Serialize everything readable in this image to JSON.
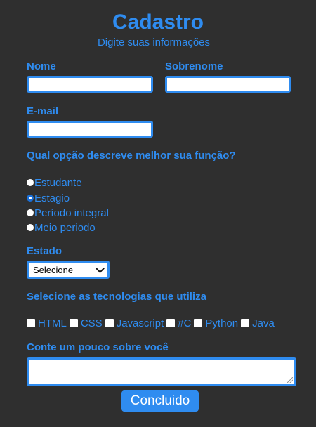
{
  "header": {
    "title": "Cadastro",
    "subtitle": "Digite suas informações"
  },
  "fields": {
    "nome_label": "Nome",
    "nome_value": "",
    "sobrenome_label": "Sobrenome",
    "sobrenome_value": "",
    "email_label": "E-mail",
    "email_value": ""
  },
  "role": {
    "question": "Qual opção descreve melhor sua função?",
    "options": [
      {
        "label": "Estudante",
        "checked": false
      },
      {
        "label": "Estagio",
        "checked": true
      },
      {
        "label": "Período integral",
        "checked": false
      },
      {
        "label": "Meio periodo",
        "checked": false
      }
    ]
  },
  "estado": {
    "label": "Estado",
    "selected": "Selecione"
  },
  "tech": {
    "question": "Selecione as tecnologias que utiliza",
    "options": [
      {
        "label": "HTML",
        "checked": false
      },
      {
        "label": "CSS",
        "checked": false
      },
      {
        "label": "Javascript",
        "checked": false
      },
      {
        "label": "#C",
        "checked": false
      },
      {
        "label": "Python",
        "checked": false
      },
      {
        "label": "Java",
        "checked": false
      }
    ]
  },
  "about": {
    "label": "Conte um pouco sobre você",
    "value": ""
  },
  "submit": {
    "label": "Concluido"
  },
  "colors": {
    "background": "#2f2f2f",
    "accent": "#2f8cf0",
    "button_text": "#ffffff"
  }
}
